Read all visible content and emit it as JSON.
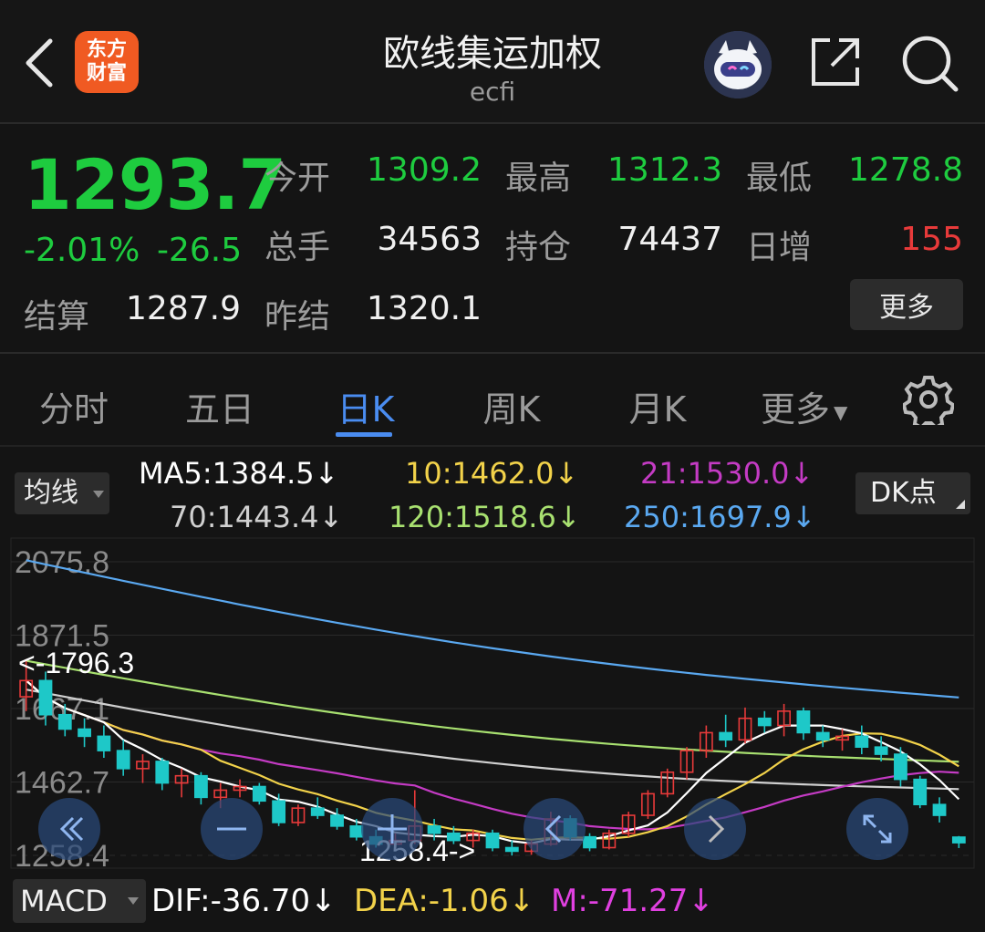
{
  "header": {
    "title": "欧线集运加权",
    "subtitle": "ecfi",
    "logo_line1": "东方",
    "logo_line2": "财富"
  },
  "quote": {
    "price": "1293.7",
    "change_pct": "-2.01%",
    "change_val": "-26.5",
    "open_label": "今开",
    "open": "1309.2",
    "high_label": "最高",
    "high": "1312.3",
    "low_label": "最低",
    "low": "1278.8",
    "volume_label": "总手",
    "volume": "34563",
    "oi_label": "持仓",
    "oi": "74437",
    "daily_inc_label": "日增",
    "daily_inc": "155",
    "settle_label": "结算",
    "settle": "1287.9",
    "prev_settle_label": "昨结",
    "prev_settle": "1320.1",
    "more_label": "更多"
  },
  "tabs": [
    {
      "label": "分时",
      "active": false
    },
    {
      "label": "五日",
      "active": false
    },
    {
      "label": "日K",
      "active": true
    },
    {
      "label": "周K",
      "active": false
    },
    {
      "label": "月K",
      "active": false
    },
    {
      "label": "更多",
      "active": false
    }
  ],
  "indicators": {
    "ma_select_label": "均线",
    "ma5": "MA5:1384.5↓",
    "ma10": "10:1462.0↓",
    "ma21": "21:1530.0↓",
    "ma70": "70:1443.4↓",
    "ma120": "120:1518.6↓",
    "ma250": "250:1697.9↓",
    "dk_label": "DK点",
    "macd_select_label": "MACD",
    "dif": "DIF:-36.70↓",
    "dea": "DEA:-1.06↓",
    "m": "M:-71.27↓"
  },
  "colors": {
    "up": "#e83a3a",
    "down": "#1ec8c8",
    "ma5": "#ffffff",
    "ma10": "#f2d24a",
    "ma21": "#c43bc4",
    "ma70": "#d0d0d0",
    "ma120": "#a8e070",
    "ma250": "#5aa8f0",
    "green_text": "#1ecc3f",
    "accent": "#4a8cf0"
  },
  "chart_data": {
    "type": "candlestick",
    "y_axis_labels": [
      "2075.8",
      "1871.5",
      "1667.1",
      "1462.7",
      "1258.4"
    ],
    "ylim": [
      1258.4,
      2075.8
    ],
    "max_marker": "<-1796.3",
    "min_marker": "1258.4->",
    "candles": [
      {
        "o": 1700,
        "h": 1805,
        "l": 1660,
        "c": 1745
      },
      {
        "o": 1745,
        "h": 1770,
        "l": 1620,
        "c": 1650
      },
      {
        "o": 1650,
        "h": 1680,
        "l": 1590,
        "c": 1610
      },
      {
        "o": 1610,
        "h": 1640,
        "l": 1560,
        "c": 1590
      },
      {
        "o": 1590,
        "h": 1620,
        "l": 1530,
        "c": 1550
      },
      {
        "o": 1550,
        "h": 1580,
        "l": 1480,
        "c": 1500
      },
      {
        "o": 1500,
        "h": 1540,
        "l": 1460,
        "c": 1520
      },
      {
        "o": 1520,
        "h": 1530,
        "l": 1440,
        "c": 1460
      },
      {
        "o": 1460,
        "h": 1500,
        "l": 1420,
        "c": 1480
      },
      {
        "o": 1480,
        "h": 1490,
        "l": 1400,
        "c": 1420
      },
      {
        "o": 1420,
        "h": 1460,
        "l": 1390,
        "c": 1440
      },
      {
        "o": 1440,
        "h": 1470,
        "l": 1420,
        "c": 1450
      },
      {
        "o": 1450,
        "h": 1460,
        "l": 1400,
        "c": 1410
      },
      {
        "o": 1410,
        "h": 1430,
        "l": 1340,
        "c": 1350
      },
      {
        "o": 1350,
        "h": 1400,
        "l": 1340,
        "c": 1390
      },
      {
        "o": 1390,
        "h": 1420,
        "l": 1360,
        "c": 1370
      },
      {
        "o": 1370,
        "h": 1390,
        "l": 1330,
        "c": 1340
      },
      {
        "o": 1340,
        "h": 1360,
        "l": 1300,
        "c": 1310
      },
      {
        "o": 1310,
        "h": 1330,
        "l": 1280,
        "c": 1290
      },
      {
        "o": 1290,
        "h": 1320,
        "l": 1270,
        "c": 1300
      },
      {
        "o": 1300,
        "h": 1440,
        "l": 1290,
        "c": 1340
      },
      {
        "o": 1340,
        "h": 1360,
        "l": 1300,
        "c": 1320
      },
      {
        "o": 1320,
        "h": 1340,
        "l": 1290,
        "c": 1300
      },
      {
        "o": 1300,
        "h": 1330,
        "l": 1280,
        "c": 1320
      },
      {
        "o": 1320,
        "h": 1330,
        "l": 1270,
        "c": 1280
      },
      {
        "o": 1280,
        "h": 1300,
        "l": 1258,
        "c": 1270
      },
      {
        "o": 1270,
        "h": 1300,
        "l": 1260,
        "c": 1290
      },
      {
        "o": 1290,
        "h": 1380,
        "l": 1285,
        "c": 1360
      },
      {
        "o": 1360,
        "h": 1370,
        "l": 1300,
        "c": 1310
      },
      {
        "o": 1310,
        "h": 1320,
        "l": 1270,
        "c": 1280
      },
      {
        "o": 1280,
        "h": 1330,
        "l": 1275,
        "c": 1320
      },
      {
        "o": 1320,
        "h": 1380,
        "l": 1310,
        "c": 1370
      },
      {
        "o": 1370,
        "h": 1440,
        "l": 1360,
        "c": 1430
      },
      {
        "o": 1430,
        "h": 1500,
        "l": 1420,
        "c": 1490
      },
      {
        "o": 1490,
        "h": 1560,
        "l": 1470,
        "c": 1550
      },
      {
        "o": 1550,
        "h": 1620,
        "l": 1530,
        "c": 1600
      },
      {
        "o": 1600,
        "h": 1650,
        "l": 1560,
        "c": 1580
      },
      {
        "o": 1580,
        "h": 1670,
        "l": 1570,
        "c": 1640
      },
      {
        "o": 1640,
        "h": 1660,
        "l": 1600,
        "c": 1620
      },
      {
        "o": 1620,
        "h": 1680,
        "l": 1590,
        "c": 1660
      },
      {
        "o": 1660,
        "h": 1670,
        "l": 1580,
        "c": 1600
      },
      {
        "o": 1600,
        "h": 1620,
        "l": 1560,
        "c": 1580
      },
      {
        "o": 1580,
        "h": 1610,
        "l": 1550,
        "c": 1590
      },
      {
        "o": 1590,
        "h": 1620,
        "l": 1540,
        "c": 1560
      },
      {
        "o": 1560,
        "h": 1590,
        "l": 1520,
        "c": 1540
      },
      {
        "o": 1540,
        "h": 1560,
        "l": 1450,
        "c": 1470
      },
      {
        "o": 1470,
        "h": 1480,
        "l": 1390,
        "c": 1400
      },
      {
        "o": 1400,
        "h": 1420,
        "l": 1350,
        "c": 1370
      },
      {
        "o": 1309.2,
        "h": 1312.3,
        "l": 1278.8,
        "c": 1293.7
      }
    ]
  }
}
